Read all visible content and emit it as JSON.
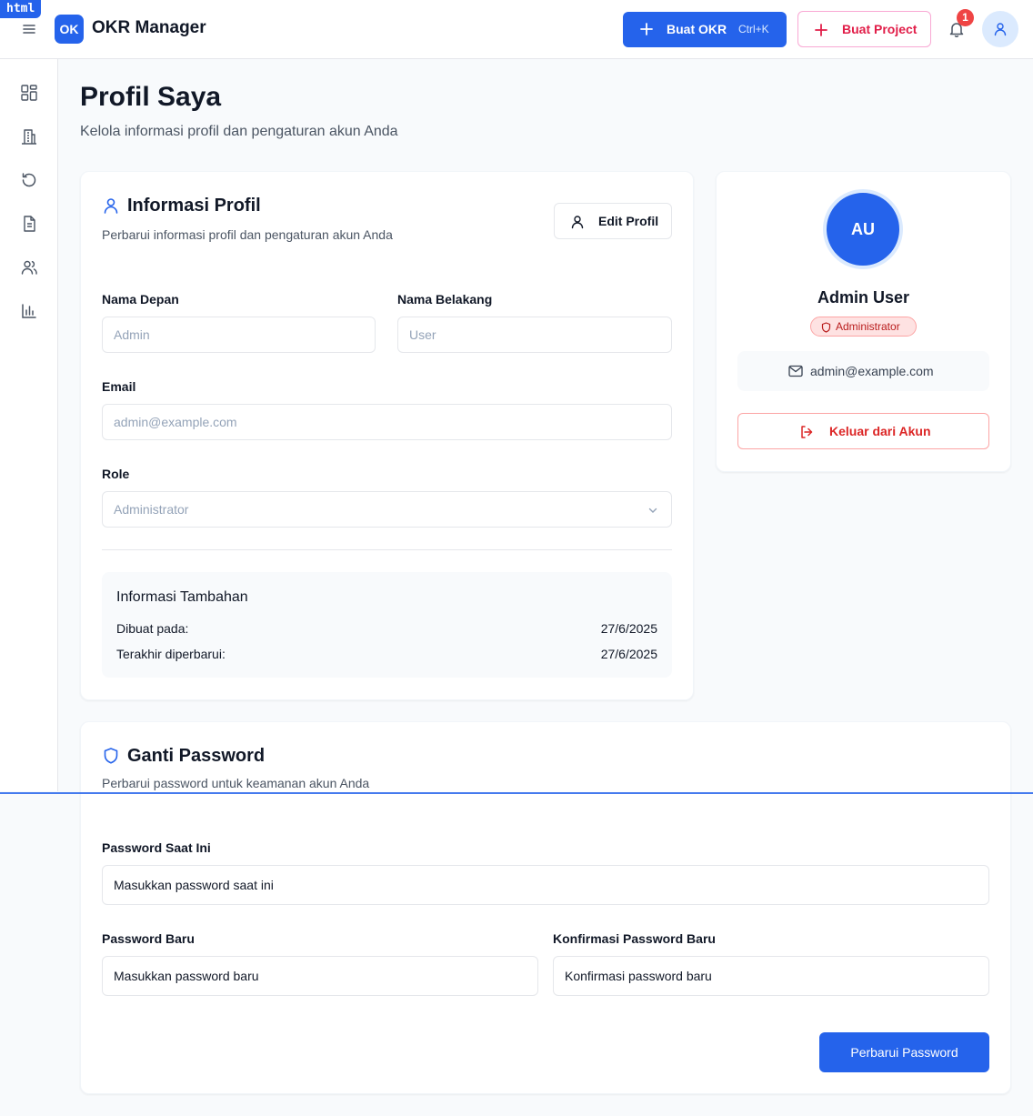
{
  "tag": "html",
  "header": {
    "logo_text": "OK",
    "app_title": "OKR Manager",
    "create_okr_label": "Buat OKR",
    "create_okr_shortcut": "Ctrl+K",
    "create_project_label": "Buat Project",
    "notification_count": "1",
    "accent_color": "#2563eb",
    "project_color": "#e11d48"
  },
  "sidebar": {
    "icons": [
      "dashboard-icon",
      "building-icon",
      "history-icon",
      "document-icon",
      "users-icon",
      "bar-chart-icon"
    ]
  },
  "page": {
    "title": "Profil Saya",
    "subtitle": "Kelola informasi profil dan pengaturan akun Anda"
  },
  "profile_info": {
    "title": "Informasi Profil",
    "subtitle": "Perbarui informasi profil dan pengaturan akun Anda",
    "edit_button": "Edit Profil",
    "first_name_label": "Nama Depan",
    "first_name_value": "Admin",
    "last_name_label": "Nama Belakang",
    "last_name_value": "User",
    "email_label": "Email",
    "email_value": "admin@example.com",
    "role_label": "Role",
    "role_value": "Administrator",
    "extra": {
      "title": "Informasi Tambahan",
      "created_label": "Dibuat pada:",
      "created_value": "27/6/2025",
      "updated_label": "Terakhir diperbarui:",
      "updated_value": "27/6/2025"
    }
  },
  "profile_card": {
    "initials": "AU",
    "name": "Admin User",
    "role_badge": "Administrator",
    "email": "admin@example.com",
    "logout_label": "Keluar dari Akun"
  },
  "password": {
    "title": "Ganti Password",
    "subtitle": "Perbarui password untuk keamanan akun Anda",
    "current_label": "Password Saat Ini",
    "current_placeholder": "Masukkan password saat ini",
    "new_label": "Password Baru",
    "new_placeholder": "Masukkan password baru",
    "confirm_label": "Konfirmasi Password Baru",
    "confirm_placeholder": "Konfirmasi password baru",
    "submit_label": "Perbarui Password"
  }
}
